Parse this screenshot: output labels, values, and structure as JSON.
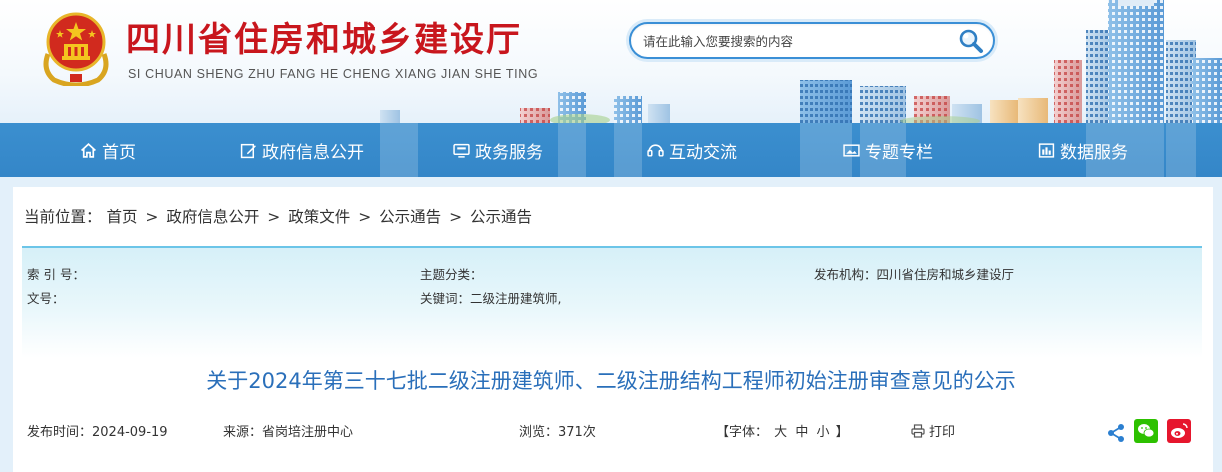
{
  "header": {
    "title": "四川省住房和城乡建设厅",
    "pinyin": "SI CHUAN SHENG ZHU FANG HE CHENG XIANG JIAN SHE TING",
    "search_placeholder": "请在此输入您要搜索的内容"
  },
  "nav": {
    "items": [
      {
        "label": "首页",
        "icon": "home-icon"
      },
      {
        "label": "政府信息公开",
        "icon": "edit-icon"
      },
      {
        "label": "政务服务",
        "icon": "monitor-icon"
      },
      {
        "label": "互动交流",
        "icon": "interact-icon"
      },
      {
        "label": "专题专栏",
        "icon": "image-icon"
      },
      {
        "label": "数据服务",
        "icon": "data-icon"
      }
    ]
  },
  "breadcrumb": {
    "prefix": "当前位置：",
    "items": [
      "首页",
      "政府信息公开",
      "政策文件",
      "公示通告",
      "公示通告"
    ],
    "separator": ">"
  },
  "meta": {
    "index_label": "索 引 号：",
    "index_value": "",
    "category_label": "主题分类：",
    "category_value": "",
    "publisher_label": "发布机构：",
    "publisher_value": "四川省住房和城乡建设厅",
    "doc_no_label": "文号：",
    "doc_no_value": "",
    "keywords_label": "关键词：",
    "keywords_value": "二级注册建筑师,"
  },
  "article": {
    "title": "关于2024年第三十七批二级注册建筑师、二级注册结构工程师初始注册审查意见的公示",
    "publish_time": "发布时间：2024-09-19",
    "source": "来源：省岗培注册中心",
    "views": "浏览：371次",
    "font_size_open": "【字体：",
    "font_large": "大",
    "font_medium": "中",
    "font_small": "小",
    "font_size_close": "】",
    "print_label": "打印"
  },
  "colors": {
    "title_red": "#c8161d",
    "nav_blue": "#3486c8",
    "article_title_blue": "#2a6fba",
    "wechat_green": "#2dc100",
    "weibo_red": "#e6162d"
  },
  "share_icons": [
    "share-icon",
    "wechat-icon",
    "weibo-icon"
  ]
}
